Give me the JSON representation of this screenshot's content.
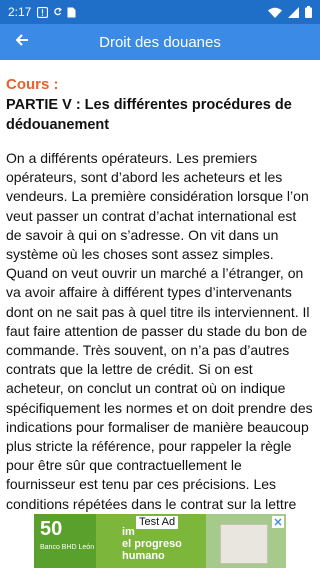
{
  "status_bar": {
    "time": "2:17",
    "icons": [
      "warning-icon",
      "sync-icon",
      "sim-card-icon",
      "wifi-icon",
      "cellular-icon",
      "battery-icon"
    ]
  },
  "app_bar": {
    "title": "Droit des douanes",
    "back_icon": "arrow-back-icon"
  },
  "content": {
    "cours_label": "Cours :",
    "heading": "PARTIE V : Les différentes procédures de dédouanement",
    "body": "On a différents opérateurs. Les premiers opérateurs, sont d’abord les acheteurs et les vendeurs. La première considération lorsque l’on veut passer un contrat d’achat international est de savoir à qui on s’adresse. On vit dans un système où les choses sont assez simples. Quand on veut ouvrir un marché a l’étranger, on va avoir affaire à différent types d’intervenants dont on ne sait pas à quel titre ils interviennent. Il faut faire attention de passer du stade du bon de commande. Très souvent, on n’a pas d’autres contrats que la lettre de crédit. Si on est acheteur, on conclut un contrat où on indique spécifiquement les normes et on doit prendre des indications pour formaliser de manière beaucoup plus stricte la référence, pour rappeler la règle pour être sûr que contractuellement le fournisseur est tenu par ces précisions. Les conditions répétées dans le contrat sur la lettre de crédit, l’importateur va se trouver dans une situation où il pourra démontrer en cas d’invalidation ou en cas de 222B remise des droits, qu’il a pris toutes les mesures nécessaires"
  },
  "ad": {
    "label": "Test Ad",
    "big_number": "50",
    "bank_text": "Banco BHD León",
    "slogan_line1": "im",
    "slogan_line2": "el progreso",
    "slogan_line3": "humano"
  },
  "colors": {
    "status_bar": "#1f6fc8",
    "app_bar": "#3b8ae6",
    "accent": "#e8622b"
  }
}
